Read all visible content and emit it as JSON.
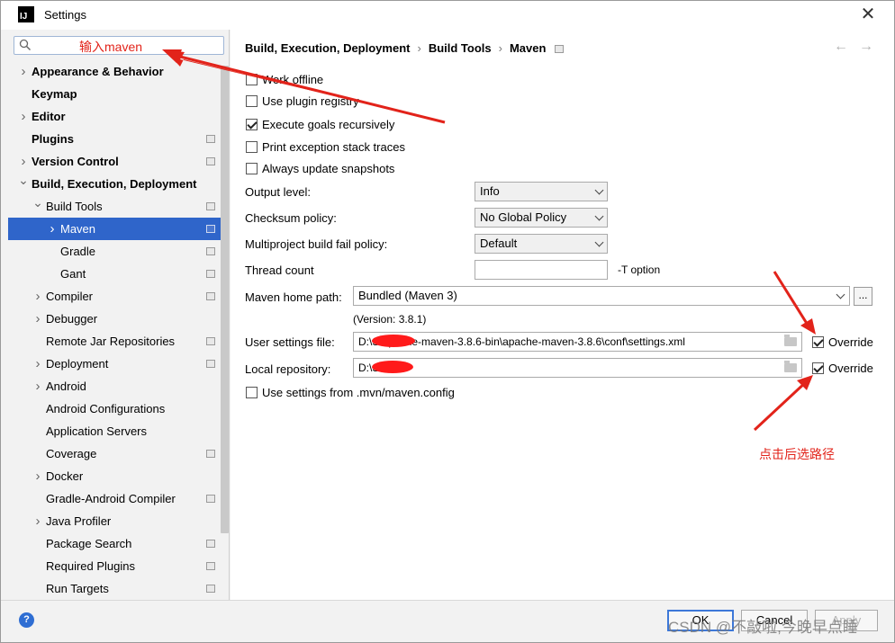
{
  "window": {
    "title": "Settings",
    "app_icon_text": "IJ",
    "close_symbol": "✕"
  },
  "search": {
    "value": "",
    "annotation": "输入maven"
  },
  "tree": [
    {
      "label": "Appearance & Behavior",
      "level": 0,
      "expandable": true,
      "expanded": false,
      "bold": true,
      "proj_icon": false,
      "selected": false
    },
    {
      "label": "Keymap",
      "level": 0,
      "expandable": false,
      "expanded": false,
      "bold": true,
      "proj_icon": false,
      "selected": false
    },
    {
      "label": "Editor",
      "level": 0,
      "expandable": true,
      "expanded": false,
      "bold": true,
      "proj_icon": false,
      "selected": false
    },
    {
      "label": "Plugins",
      "level": 0,
      "expandable": false,
      "expanded": false,
      "bold": true,
      "proj_icon": true,
      "selected": false
    },
    {
      "label": "Version Control",
      "level": 0,
      "expandable": true,
      "expanded": false,
      "bold": true,
      "proj_icon": true,
      "selected": false
    },
    {
      "label": "Build, Execution, Deployment",
      "level": 0,
      "expandable": true,
      "expanded": true,
      "bold": true,
      "proj_icon": false,
      "selected": false
    },
    {
      "label": "Build Tools",
      "level": 1,
      "expandable": true,
      "expanded": true,
      "bold": false,
      "proj_icon": true,
      "selected": false
    },
    {
      "label": "Maven",
      "level": 2,
      "expandable": true,
      "expanded": false,
      "bold": false,
      "proj_icon": true,
      "selected": true
    },
    {
      "label": "Gradle",
      "level": 2,
      "expandable": false,
      "expanded": false,
      "bold": false,
      "proj_icon": true,
      "selected": false
    },
    {
      "label": "Gant",
      "level": 2,
      "expandable": false,
      "expanded": false,
      "bold": false,
      "proj_icon": true,
      "selected": false
    },
    {
      "label": "Compiler",
      "level": 1,
      "expandable": true,
      "expanded": false,
      "bold": false,
      "proj_icon": true,
      "selected": false
    },
    {
      "label": "Debugger",
      "level": 1,
      "expandable": true,
      "expanded": false,
      "bold": false,
      "proj_icon": false,
      "selected": false
    },
    {
      "label": "Remote Jar Repositories",
      "level": 1,
      "expandable": false,
      "expanded": false,
      "bold": false,
      "proj_icon": true,
      "selected": false
    },
    {
      "label": "Deployment",
      "level": 1,
      "expandable": true,
      "expanded": false,
      "bold": false,
      "proj_icon": true,
      "selected": false
    },
    {
      "label": "Android",
      "level": 1,
      "expandable": true,
      "expanded": false,
      "bold": false,
      "proj_icon": false,
      "selected": false
    },
    {
      "label": "Android Configurations",
      "level": 1,
      "expandable": false,
      "expanded": false,
      "bold": false,
      "proj_icon": false,
      "selected": false
    },
    {
      "label": "Application Servers",
      "level": 1,
      "expandable": false,
      "expanded": false,
      "bold": false,
      "proj_icon": false,
      "selected": false
    },
    {
      "label": "Coverage",
      "level": 1,
      "expandable": false,
      "expanded": false,
      "bold": false,
      "proj_icon": true,
      "selected": false
    },
    {
      "label": "Docker",
      "level": 1,
      "expandable": true,
      "expanded": false,
      "bold": false,
      "proj_icon": false,
      "selected": false
    },
    {
      "label": "Gradle-Android Compiler",
      "level": 1,
      "expandable": false,
      "expanded": false,
      "bold": false,
      "proj_icon": true,
      "selected": false
    },
    {
      "label": "Java Profiler",
      "level": 1,
      "expandable": true,
      "expanded": false,
      "bold": false,
      "proj_icon": false,
      "selected": false
    },
    {
      "label": "Package Search",
      "level": 1,
      "expandable": false,
      "expanded": false,
      "bold": false,
      "proj_icon": true,
      "selected": false
    },
    {
      "label": "Required Plugins",
      "level": 1,
      "expandable": false,
      "expanded": false,
      "bold": false,
      "proj_icon": true,
      "selected": false
    },
    {
      "label": "Run Targets",
      "level": 1,
      "expandable": false,
      "expanded": false,
      "bold": false,
      "proj_icon": true,
      "selected": false
    }
  ],
  "breadcrumb": {
    "parts": [
      "Build, Execution, Deployment",
      "Build Tools",
      "Maven"
    ],
    "separator": "›"
  },
  "nav": {
    "back": "←",
    "forward": "→"
  },
  "checkboxes": [
    {
      "label": "Work offline",
      "checked": false
    },
    {
      "label": "Use plugin registry",
      "checked": false
    },
    {
      "label": "Execute goals recursively",
      "checked": true
    },
    {
      "label": "Print exception stack traces",
      "checked": false
    },
    {
      "label": "Always update snapshots",
      "checked": false
    }
  ],
  "output_level": {
    "label": "Output level:",
    "value": "Info"
  },
  "checksum_policy": {
    "label": "Checksum policy:",
    "value": "No Global Policy"
  },
  "fail_policy": {
    "label": "Multiproject build fail policy:",
    "value": "Default"
  },
  "thread_count": {
    "label": "Thread count",
    "value": "",
    "suffix": "-T option"
  },
  "maven_home": {
    "label": "Maven home path:",
    "value": "Bundled (Maven 3)",
    "version": "(Version: 3.8.1)",
    "browse": "..."
  },
  "user_settings": {
    "label": "User settings file:",
    "value": "D:\\S\\apache-maven-3.8.6-bin\\apache-maven-3.8.6\\conf\\settings.xml",
    "override_label": "Override",
    "override_checked": true
  },
  "local_repo": {
    "label": "Local repository:",
    "value": "D:\\S\\.m2",
    "override_label": "Override",
    "override_checked": true
  },
  "mvn_config": {
    "label": "Use settings from .mvn/maven.config",
    "checked": false
  },
  "annotation_override": "点击后选路径",
  "footer": {
    "help": "?",
    "ok": "OK",
    "cancel": "Cancel",
    "apply": "Apply"
  },
  "watermark": "CSDN @不敲啦,今晚早点睡",
  "colors": {
    "selection": "#2f65ca",
    "annotation": "#e2231a",
    "help_button": "#2f6ed3"
  }
}
